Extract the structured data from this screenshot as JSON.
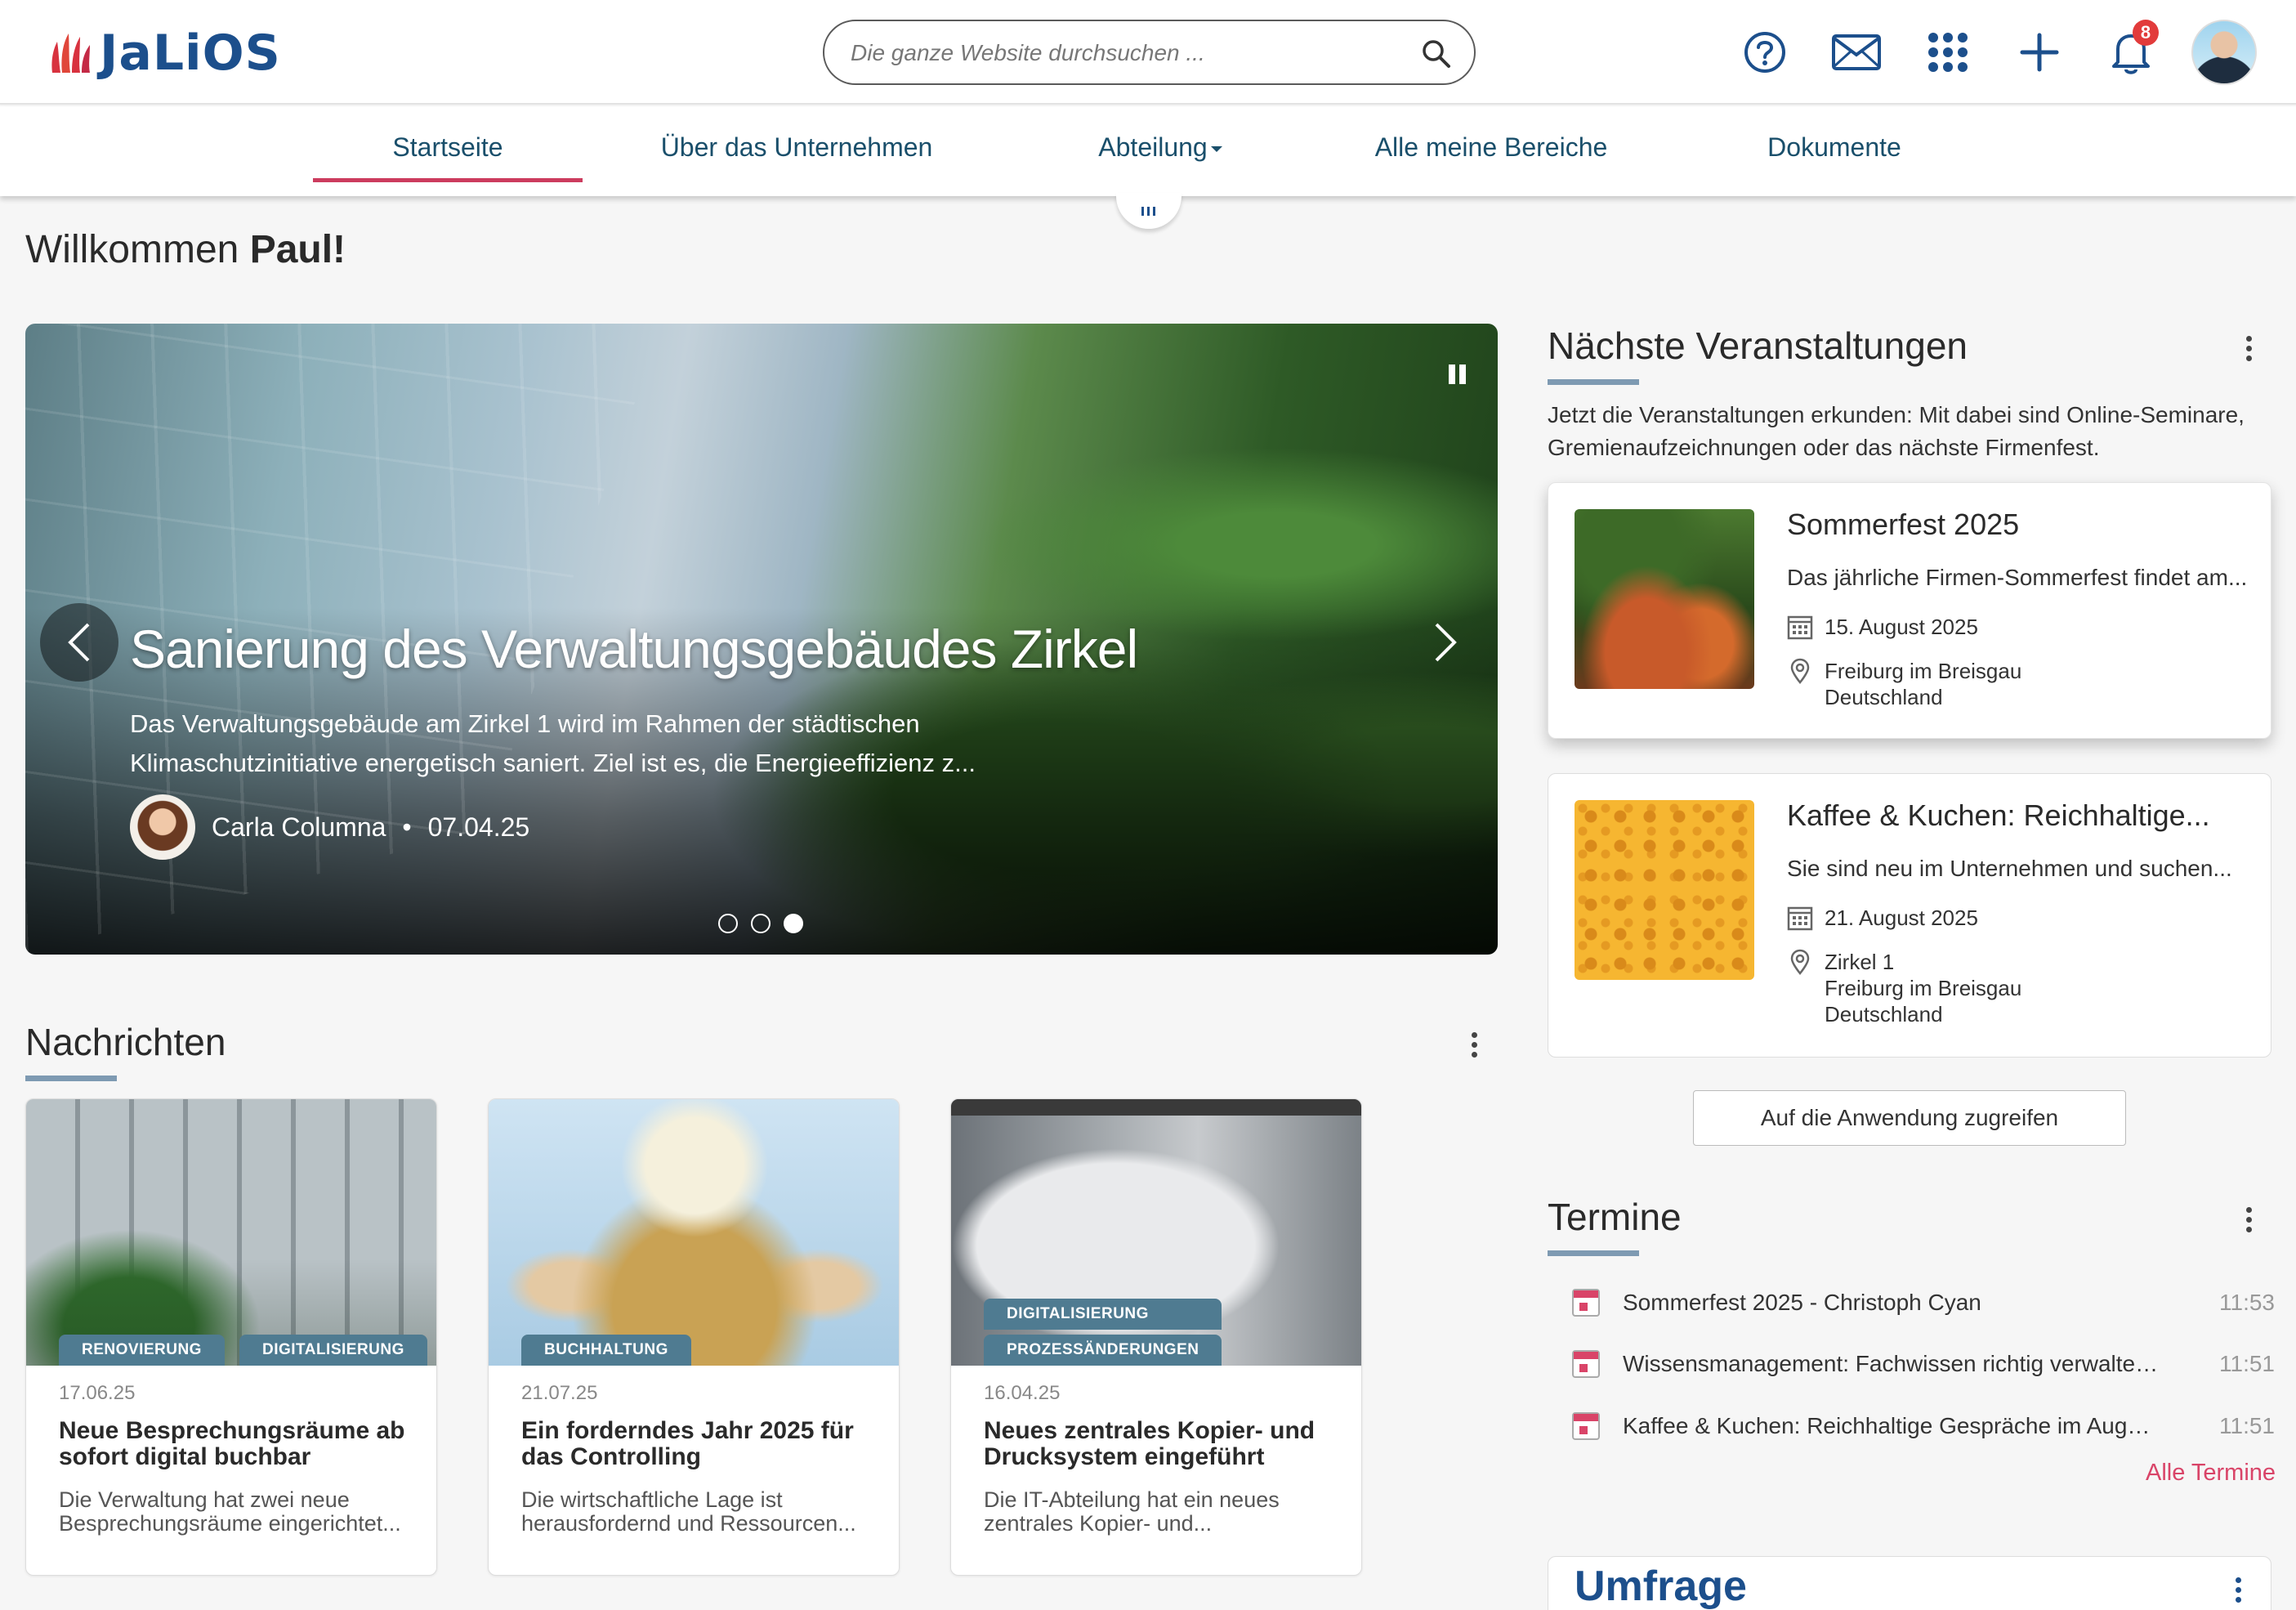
{
  "app": {
    "logo_text": "JaLiOS"
  },
  "search": {
    "placeholder": "Die ganze Website durchsuchen ..."
  },
  "header": {
    "notifications_count": "8"
  },
  "nav": {
    "items": [
      {
        "label": "Startseite"
      },
      {
        "label": "Über das Unternehmen"
      },
      {
        "label": "Abteilung"
      },
      {
        "label": "Alle meine Bereiche"
      },
      {
        "label": "Dokumente"
      }
    ]
  },
  "welcome": {
    "prefix": "Willkommen ",
    "name": "Paul!"
  },
  "hero": {
    "title": "Sanierung des Verwaltungsgebäudes Zirkel",
    "text": "Das Verwaltungsgebäude am Zirkel 1 wird im Rahmen der städtischen Klimaschutzinitiative energetisch saniert. Ziel ist es, die Energieeffizienz z...",
    "author": "Carla Columna",
    "separator": "•",
    "date": "07.04.25"
  },
  "news": {
    "title": "Nachrichten",
    "cards": [
      {
        "tags": [
          "RENOVIERUNG",
          "DIGITALISIERUNG"
        ],
        "date": "17.06.25",
        "title": "Neue Besprechungsräume ab sofort digital buchbar",
        "text": "Die Verwaltung hat zwei neue Besprechungsräume eingerichtet..."
      },
      {
        "tags": [
          "BUCHHALTUNG"
        ],
        "date": "21.07.25",
        "title": "Ein forderndes Jahr 2025 für das Controlling",
        "text": "Die wirtschaftliche Lage ist herausfordernd und Ressourcen..."
      },
      {
        "tags": [
          "DIGITALISIERUNG",
          "PROZESSÄNDERUNGEN"
        ],
        "date": "16.04.25",
        "title": "Neues zentrales Kopier- und Drucksystem eingeführt",
        "text": "Die IT-Abteilung hat ein neues zentrales Kopier- und..."
      }
    ]
  },
  "events": {
    "title": "Nächste Veranstaltungen",
    "intro": "Jetzt die Veranstaltungen erkunden: Mit dabei sind Online-Seminare, Gremienaufzeichnungen oder das nächste Firmenfest.",
    "items": [
      {
        "title": "Sommerfest 2025",
        "desc": "Das jährliche Firmen-Sommerfest findet am...",
        "date": "15. August 2025",
        "location_line1": "Freiburg im Breisgau",
        "location_line2": "Deutschland",
        "location_line3": ""
      },
      {
        "title": "Kaffee & Kuchen: Reichhaltige...",
        "desc": "Sie sind neu im Unternehmen und suchen...",
        "date": "21. August 2025",
        "location_line1": "Zirkel 1",
        "location_line2": "Freiburg im Breisgau",
        "location_line3": "Deutschland"
      }
    ],
    "access_button": "Auf die Anwendung zugreifen"
  },
  "termine": {
    "title": "Termine",
    "items": [
      {
        "title": "Sommerfest 2025 - Christoph Cyan",
        "time": "11:53"
      },
      {
        "title": "Wissensmanagement: Fachwissen richtig verwalten...",
        "time": "11:51"
      },
      {
        "title": "Kaffee & Kuchen: Reichhaltige Gespräche im Augus...",
        "time": "11:51"
      }
    ],
    "all_link": "Alle Termine"
  },
  "umfrage": {
    "title": "Umfrage"
  },
  "colors": {
    "accent": "#cc3c5e",
    "brand": "#1c4f8c",
    "tag": "#4f7b91",
    "section_bar": "#7e9ab2"
  },
  "icons": [
    "help-icon",
    "mail-icon",
    "apps-grid-icon",
    "plus-icon",
    "bell-icon",
    "search-icon",
    "calendar-icon",
    "location-pin-icon",
    "kebab-menu-icon",
    "chevron-left-icon",
    "chevron-right-icon",
    "pause-icon"
  ]
}
